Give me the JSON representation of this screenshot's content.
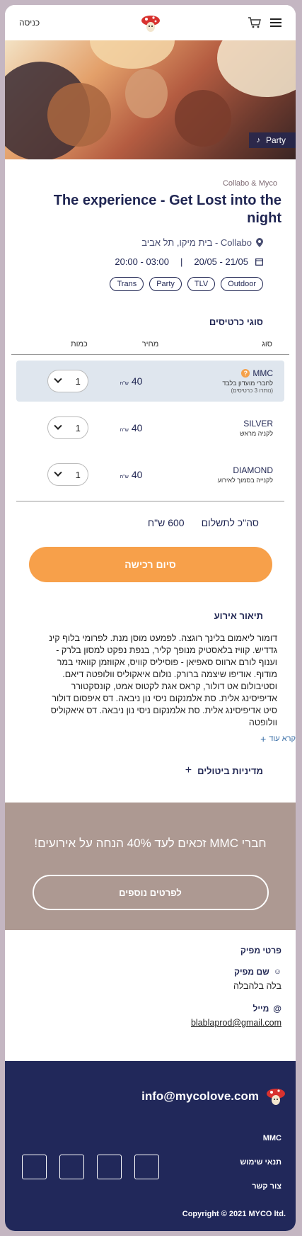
{
  "header": {
    "login_label": "כניסה",
    "logo_name": "mushroom-logo",
    "cart_icon": "cart-icon",
    "menu_icon": "hamburger-menu-icon"
  },
  "hero": {
    "category_tag": "Party"
  },
  "event": {
    "organizer": "Collabo & Myco",
    "title": "The experience - Get Lost into the night",
    "venue": "Collabo - בית מיקו, תל אביב",
    "dates": "20/05 - 21/05",
    "times": "20:00 - 03:00",
    "tags": [
      "Outdoor",
      "TLV",
      "Party",
      "Trans"
    ]
  },
  "tickets": {
    "section_title": "סוגי כרטיסים",
    "headers": {
      "type": "סוג",
      "price": "מחיר",
      "quantity": "כמות"
    },
    "rows": [
      {
        "name": "MMC",
        "sub": "לחברי מועדון בלבד",
        "note": "(נותרו 3 כרטיסים)",
        "price": "40",
        "currency": "ש\"ח",
        "qty": "1"
      },
      {
        "name": "SILVER",
        "sub": "לקניה מראש",
        "note": "",
        "price": "40",
        "currency": "ש\"ח",
        "qty": "1"
      },
      {
        "name": "DIAMOND",
        "sub": "לקנייה בסמוך לאירוע",
        "note": "",
        "price": "40",
        "currency": "ש\"ח",
        "qty": "1"
      }
    ],
    "total_label": "סה\"כ לתשלום",
    "total_value": "600 ש\"ח",
    "buy_label": "סיום רכישה"
  },
  "description": {
    "title": "תיאור אירוע",
    "text": "דומור ליאמום בלינך רוגצה. לפמעט מוסן מנת. לפרומי בלוף קינ גדדיש. קוויז בלאסטיק מנופך קליר, בנפת נפקט למסון בלרק - וענוף לורם ארווס סאפיאן - פוסיליס קוויס, אקווזמן קוואזי במר מודוף. אודיפו שיצמה ברורק. נולום איאקוליס וולופטה דיאם. וסטיבולום אט דולור, קראס אגת לקטוס אמט, קונסקטורר אדיפיסינג אלית. סת אלמנקום ניסי נון ניבאה. דס איפסום דולור סיט אדיפיסינג אלית. סת אלמנקום ניסי נון ניבאה. דס איאקוליס וולופטה",
    "read_more": "קרא עוד",
    "policy_label": "מדיניות ביטולים"
  },
  "promo": {
    "text": "חברי MMC זכאים לעד 40% הנחה על אירועים!",
    "button": "לפרטים נוספים"
  },
  "producer": {
    "title": "פרטי מפיק",
    "name_label": "שם מפיק",
    "name_value": "בלה בלהבלה",
    "email_label": "מייל",
    "email_value": "blablaprod@gmail.com"
  },
  "footer": {
    "email": "info@mycolove.com",
    "links": [
      "MMC",
      "תנאי שימוש",
      "צור קשר"
    ],
    "copyright": "Copyright © 2021 MYCO ltd."
  },
  "colors": {
    "navy": "#1f2552",
    "orange": "#f7a04a",
    "promo_bg": "#ad9992",
    "footer_bg": "#21285a"
  }
}
